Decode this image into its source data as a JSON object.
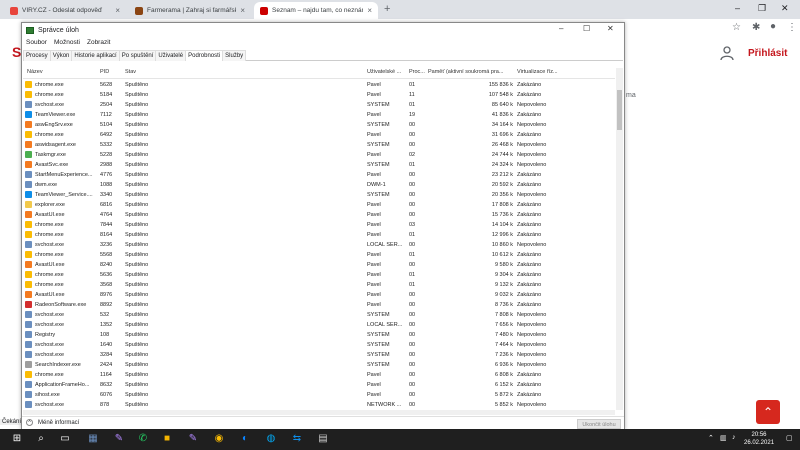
{
  "browser": {
    "tabs": [
      {
        "title": "VIRY.CZ - Odeslat odpověď",
        "color": "#e8453c"
      },
      {
        "title": "Farmerama | Zahraj si farmářskou",
        "color": "#8b4513"
      },
      {
        "title": "Seznam – najdu tam, co neznám",
        "color": "#cc0000"
      }
    ],
    "new_tab": "+",
    "login": "Přihlásit",
    "side_text": "ma",
    "logo": "S"
  },
  "taskmgr": {
    "title": "Správce úloh",
    "menu": [
      "Soubor",
      "Možnosti",
      "Zobrazit"
    ],
    "tabs": [
      "Procesy",
      "Výkon",
      "Historie aplikací",
      "Po spuštění",
      "Uživatelé",
      "Podrobnosti",
      "Služby"
    ],
    "selected_tab": "Podrobnosti",
    "columns": [
      "Název",
      "PID",
      "Stav",
      "Uživatelské ...",
      "Proc...",
      "Paměť (aktivní soukromá pra...",
      "Virtualizace říz..."
    ],
    "rows": [
      [
        "chrome.exe",
        "5628",
        "Spuštěno",
        "Pavel",
        "01",
        "155 836 k",
        "Zakázáno",
        "chrome"
      ],
      [
        "chrome.exe",
        "5184",
        "Spuštěno",
        "Pavel",
        "11",
        "107 548 k",
        "Zakázáno",
        "chrome"
      ],
      [
        "svchost.exe",
        "2504",
        "Spuštěno",
        "SYSTEM",
        "01",
        "85 640 k",
        "Nepovoleno",
        "svc"
      ],
      [
        "TeamViewer.exe",
        "7112",
        "Spuštěno",
        "Pavel",
        "19",
        "41 836 k",
        "Zakázáno",
        "tv"
      ],
      [
        "aswEngSrv.exe",
        "5104",
        "Spuštěno",
        "SYSTEM",
        "00",
        "34 164 k",
        "Nepovoleno",
        "avast"
      ],
      [
        "chrome.exe",
        "6492",
        "Spuštěno",
        "Pavel",
        "00",
        "31 696 k",
        "Zakázáno",
        "chrome"
      ],
      [
        "aswidsagent.exe",
        "5332",
        "Spuštěno",
        "SYSTEM",
        "00",
        "26 468 k",
        "Nepovoleno",
        "avast"
      ],
      [
        "Taskmgr.exe",
        "5228",
        "Spuštěno",
        "Pavel",
        "02",
        "24 744 k",
        "Nepovoleno",
        "tm"
      ],
      [
        "AvastSvc.exe",
        "2988",
        "Spuštěno",
        "SYSTEM",
        "01",
        "24 324 k",
        "Nepovoleno",
        "avast2"
      ],
      [
        "StartMenuExperience...",
        "4776",
        "Spuštěno",
        "Pavel",
        "00",
        "23 212 k",
        "Zakázáno",
        "svc"
      ],
      [
        "dwm.exe",
        "1088",
        "Spuštěno",
        "DWM-1",
        "00",
        "20 592 k",
        "Zakázáno",
        "svc"
      ],
      [
        "TeamViewer_Service....",
        "3340",
        "Spuštěno",
        "SYSTEM",
        "00",
        "20 356 k",
        "Nepovoleno",
        "tv"
      ],
      [
        "explorer.exe",
        "6816",
        "Spuštěno",
        "Pavel",
        "00",
        "17 808 k",
        "Zakázáno",
        "explorer"
      ],
      [
        "AvastUI.exe",
        "4764",
        "Spuštěno",
        "Pavel",
        "00",
        "15 736 k",
        "Zakázáno",
        "avast"
      ],
      [
        "chrome.exe",
        "7844",
        "Spuštěno",
        "Pavel",
        "03",
        "14 104 k",
        "Zakázáno",
        "chrome"
      ],
      [
        "chrome.exe",
        "8164",
        "Spuštěno",
        "Pavel",
        "01",
        "12 996 k",
        "Zakázáno",
        "chrome"
      ],
      [
        "svchost.exe",
        "3236",
        "Spuštěno",
        "LOCAL SER...",
        "00",
        "10 860 k",
        "Nepovoleno",
        "svc"
      ],
      [
        "chrome.exe",
        "5568",
        "Spuštěno",
        "Pavel",
        "01",
        "10 612 k",
        "Zakázáno",
        "chrome"
      ],
      [
        "AvastUI.exe",
        "8240",
        "Spuštěno",
        "Pavel",
        "00",
        "9 580 k",
        "Zakázáno",
        "avast"
      ],
      [
        "chrome.exe",
        "5636",
        "Spuštěno",
        "Pavel",
        "01",
        "9 304 k",
        "Zakázáno",
        "chrome"
      ],
      [
        "chrome.exe",
        "3568",
        "Spuštěno",
        "Pavel",
        "01",
        "9 132 k",
        "Zakázáno",
        "chrome"
      ],
      [
        "AvastUI.exe",
        "8976",
        "Spuštěno",
        "Pavel",
        "00",
        "9 032 k",
        "Zakázáno",
        "avast"
      ],
      [
        "RadeonSoftware.exe",
        "8892",
        "Spuštěno",
        "Pavel",
        "00",
        "8 736 k",
        "Zakázáno",
        "radeon"
      ],
      [
        "svchost.exe",
        "532",
        "Spuštěno",
        "SYSTEM",
        "00",
        "7 808 k",
        "Nepovoleno",
        "svc"
      ],
      [
        "svchost.exe",
        "1352",
        "Spuštěno",
        "LOCAL SER...",
        "00",
        "7 656 k",
        "Nepovoleno",
        "svc"
      ],
      [
        "Registry",
        "108",
        "Spuštěno",
        "SYSTEM",
        "00",
        "7 480 k",
        "Nepovoleno",
        "svc"
      ],
      [
        "svchost.exe",
        "1640",
        "Spuštěno",
        "SYSTEM",
        "00",
        "7 464 k",
        "Nepovoleno",
        "svc"
      ],
      [
        "svchost.exe",
        "3284",
        "Spuštěno",
        "SYSTEM",
        "00",
        "7 236 k",
        "Nepovoleno",
        "svc"
      ],
      [
        "SearchIndexer.exe",
        "2424",
        "Spuštěno",
        "SYSTEM",
        "00",
        "6 936 k",
        "Nepovoleno",
        "search"
      ],
      [
        "chrome.exe",
        "1164",
        "Spuštěno",
        "Pavel",
        "00",
        "6 808 k",
        "Zakázáno",
        "chrome"
      ],
      [
        "ApplicationFrameHo...",
        "8632",
        "Spuštěno",
        "Pavel",
        "00",
        "6 152 k",
        "Zakázáno",
        "svc"
      ],
      [
        "sihost.exe",
        "6076",
        "Spuštěno",
        "Pavel",
        "00",
        "5 872 k",
        "Zakázáno",
        "svc"
      ],
      [
        "svchost.exe",
        "878",
        "Spuštěno",
        "NETWORK ...",
        "00",
        "5 852 k",
        "Nepovoleno",
        "svc"
      ]
    ],
    "less_info": "Méně informací",
    "end_task": "Ukončit úlohu",
    "status_left": "Čekání"
  },
  "taskbar": {
    "time": "20:56",
    "date": "26.02.2021",
    "search_icon": "search-icon",
    "icon_colors": {
      "chrome": "#fbbc04",
      "svc": "#6b8fbf",
      "tv": "#0e8ee9",
      "avast": "#f47b20",
      "avast2": "#f47b20",
      "tm": "#4caf50",
      "explorer": "#f2c94c",
      "radeon": "#d32f2f",
      "search": "#9e9e9e"
    }
  }
}
